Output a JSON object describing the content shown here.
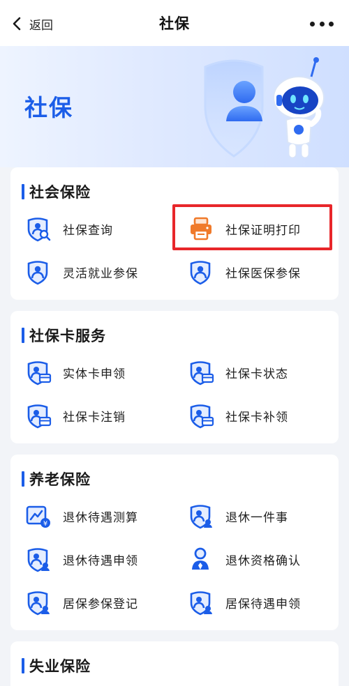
{
  "nav": {
    "back_label": "返回",
    "title": "社保"
  },
  "banner": {
    "title": "社保"
  },
  "sections": [
    {
      "title": "社会保险",
      "items": [
        {
          "label": "社保查询",
          "icon": "shield-search-icon"
        },
        {
          "label": "社保证明打印",
          "icon": "printer-icon"
        },
        {
          "label": "灵活就业参保",
          "icon": "shield-user-icon"
        },
        {
          "label": "社保医保参保",
          "icon": "shield-user-icon"
        }
      ]
    },
    {
      "title": "社保卡服务",
      "items": [
        {
          "label": "实体卡申领",
          "icon": "shield-card-icon"
        },
        {
          "label": "社保卡状态",
          "icon": "shield-card-icon"
        },
        {
          "label": "社保卡注销",
          "icon": "shield-card-icon"
        },
        {
          "label": "社保卡补领",
          "icon": "shield-card-icon"
        }
      ]
    },
    {
      "title": "养老保险",
      "items": [
        {
          "label": "退休待遇测算",
          "icon": "calculator-icon"
        },
        {
          "label": "退休一件事",
          "icon": "shield-user-icon"
        },
        {
          "label": "退休待遇申领",
          "icon": "shield-user-icon"
        },
        {
          "label": "退休资格确认",
          "icon": "person-badge-icon"
        },
        {
          "label": "居保参保登记",
          "icon": "shield-user-icon"
        },
        {
          "label": "居保待遇申领",
          "icon": "shield-user-icon"
        }
      ]
    },
    {
      "title": "失业保险",
      "items": []
    }
  ],
  "colors": {
    "accent": "#1b5de8",
    "printer": "#f07a2a",
    "highlight": "#e8262a"
  }
}
